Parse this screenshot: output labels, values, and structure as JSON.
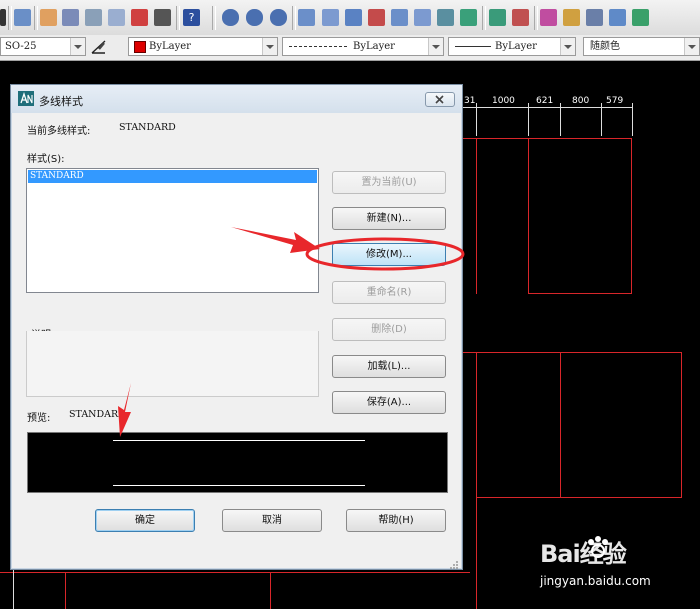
{
  "toolbar": {
    "dimstyle_value": "SO-25",
    "color_value": "ByLayer",
    "linetype_value": "ByLayer",
    "lineweight_value": "ByLayer",
    "plotstyle_value": "随颜色"
  },
  "drawing": {
    "dims": [
      "31",
      "1000",
      "621",
      "800",
      "579"
    ],
    "colors": {
      "line": "#d8262a",
      "background": "#000000"
    }
  },
  "dialog": {
    "title": "多线样式",
    "current_label": "当前多线样式:",
    "current_value": "STANDARD",
    "styles_label": "样式(S):",
    "styles": [
      "STANDARD"
    ],
    "description_label": "说明:",
    "preview_label": "预览:",
    "preview_value": "STANDARD",
    "buttons": {
      "set_current": "置为当前(U)",
      "new": "新建(N)...",
      "modify": "修改(M)...",
      "rename": "重命名(R)",
      "delete": "删除(D)",
      "load": "加载(L)...",
      "save": "保存(A)...",
      "ok": "确定",
      "cancel": "取消",
      "help": "帮助(H)"
    }
  },
  "watermark": {
    "brand": "Bai经验",
    "url": "jingyan.baidu.com"
  }
}
